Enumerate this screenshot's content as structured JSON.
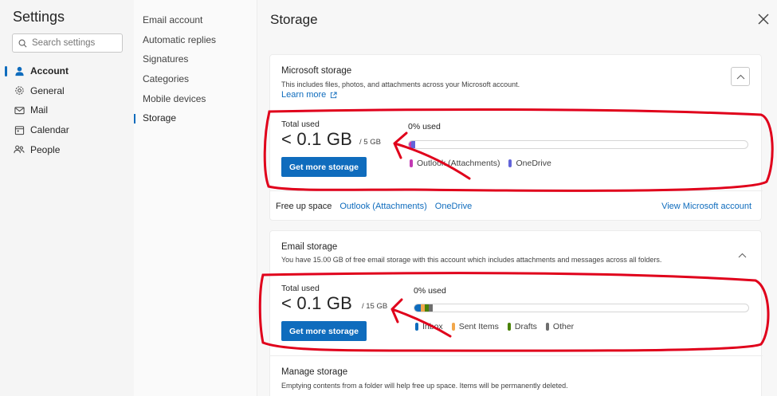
{
  "nav": {
    "title": "Settings",
    "search_placeholder": "Search settings",
    "items": [
      {
        "label": "Account",
        "icon": "person-icon",
        "active": true
      },
      {
        "label": "General",
        "icon": "gear-icon"
      },
      {
        "label": "Mail",
        "icon": "mail-icon"
      },
      {
        "label": "Calendar",
        "icon": "calendar-icon"
      },
      {
        "label": "People",
        "icon": "people-icon"
      }
    ]
  },
  "subnav": {
    "items": [
      {
        "label": "Email account"
      },
      {
        "label": "Automatic replies"
      },
      {
        "label": "Signatures"
      },
      {
        "label": "Categories"
      },
      {
        "label": "Mobile devices"
      },
      {
        "label": "Storage",
        "active": true
      }
    ]
  },
  "main": {
    "title": "Storage",
    "microsoft": {
      "heading": "Microsoft storage",
      "description": "This includes files, photos, and attachments across your Microsoft account.",
      "learn_more": "Learn more",
      "total_used_label": "Total used",
      "total_used_value": "< 0.1 GB",
      "total_of": "/ 5 GB",
      "button": "Get more storage",
      "percent_used": "0% used",
      "legend": [
        {
          "label": "Outlook (Attachments)",
          "color": "#c239b3",
          "fill": 0.0045
        },
        {
          "label": "OneDrive",
          "color": "#6264d9",
          "fill": 0.012
        }
      ],
      "free_up": {
        "label": "Free up space",
        "links": [
          "Outlook (Attachments)",
          "OneDrive"
        ],
        "right_link": "View Microsoft account"
      }
    },
    "email": {
      "heading": "Email storage",
      "description": "You have 15.00 GB of free email storage with this account which includes attachments and messages across all folders.",
      "total_used_label": "Total used",
      "total_used_value": "< 0.1 GB",
      "total_of": "/ 15 GB",
      "button": "Get more storage",
      "percent_used": "0% used",
      "legend": [
        {
          "label": "Inbox",
          "color": "#0f6cbd",
          "fill": 0.018
        },
        {
          "label": "Sent Items",
          "color": "#f2a74b",
          "fill": 0.012
        },
        {
          "label": "Drafts",
          "color": "#498205",
          "fill": 0.012
        },
        {
          "label": "Other",
          "color": "#6e6e6e",
          "fill": 0.012
        }
      ]
    },
    "manage": {
      "heading": "Manage storage",
      "description": "Emptying contents from a folder will help free up space. Items will be permanently deleted."
    }
  },
  "colors": {
    "accent": "#0f6cbd",
    "annotation": "#e0001b"
  }
}
